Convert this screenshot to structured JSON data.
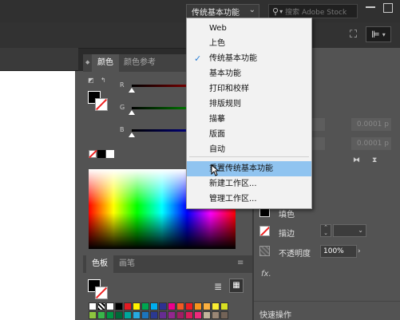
{
  "topbar": {
    "workspace_switcher": "传统基本功能",
    "stock_search_placeholder": "搜索 Adobe Stock"
  },
  "workspace_menu": {
    "items": [
      {
        "label": "Web",
        "checked": false
      },
      {
        "label": "上色",
        "checked": false
      },
      {
        "label": "传统基本功能",
        "checked": true
      },
      {
        "label": "基本功能",
        "checked": false
      },
      {
        "label": "打印和校样",
        "checked": false
      },
      {
        "label": "排版规则",
        "checked": false
      },
      {
        "label": "描摹",
        "checked": false
      },
      {
        "label": "版面",
        "checked": false
      },
      {
        "label": "自动",
        "checked": false
      }
    ],
    "actions": [
      {
        "label": "重置传统基本功能",
        "highlighted": true
      },
      {
        "label": "新建工作区...",
        "highlighted": false
      },
      {
        "label": "管理工作区...",
        "highlighted": false
      }
    ],
    "check_glyph": "✓"
  },
  "color_panel": {
    "tabs": [
      "颜色",
      "颜色参考"
    ],
    "sliders": [
      {
        "label": "R",
        "color": "#cc2222"
      },
      {
        "label": "G",
        "color": "#22aa22"
      },
      {
        "label": "B",
        "color": "#2233cc"
      }
    ]
  },
  "swatches_panel": {
    "tabs": [
      "色板",
      "画笔"
    ]
  },
  "properties_panel": {
    "fill_label": "填色",
    "stroke_label": "描边",
    "opacity_label": "不透明度",
    "opacity_value": "100%",
    "dim_value_1": "0.0001 p",
    "dim_value_2": "0.0001 p",
    "fx_label": "fx.",
    "quick_actions_label": "快速操作"
  }
}
